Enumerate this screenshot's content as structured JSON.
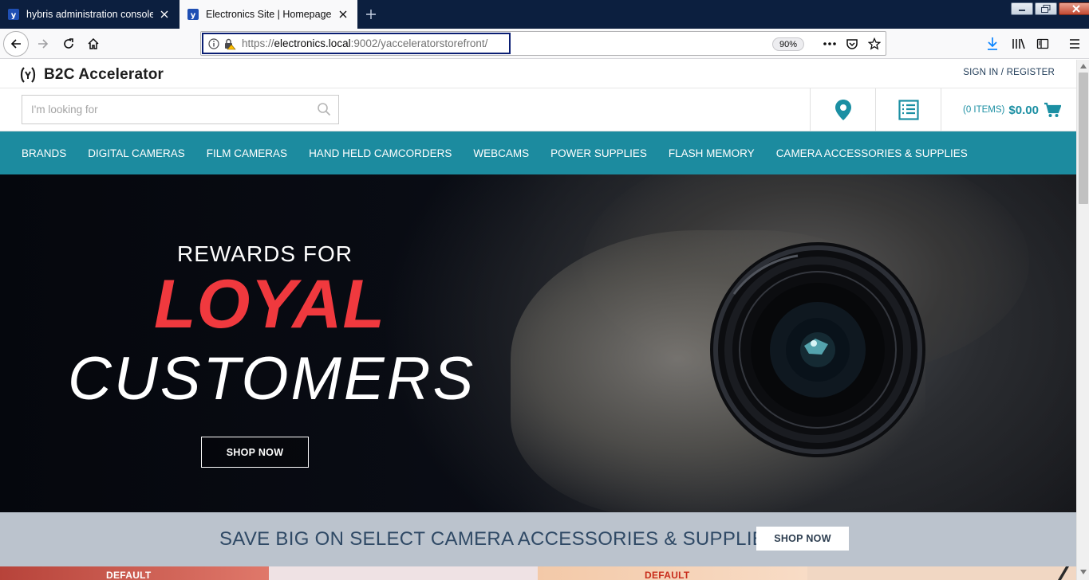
{
  "browser": {
    "tabs": [
      {
        "title": "hybris administration console |",
        "active": false
      },
      {
        "title": "Electronics Site | Homepage",
        "active": true
      }
    ],
    "url": {
      "scheme": "https://",
      "host": "electronics.local",
      "rest": ":9002/yacceleratorstorefront/"
    },
    "zoom": "90%"
  },
  "site": {
    "brand": "B2C Accelerator",
    "signin": "SIGN IN / REGISTER",
    "search_placeholder": "I'm looking for",
    "cart": {
      "items": "(0 ITEMS)",
      "total": "$0.00"
    },
    "categories": [
      "BRANDS",
      "DIGITAL CAMERAS",
      "FILM CAMERAS",
      "HAND HELD CAMCORDERS",
      "WEBCAMS",
      "POWER SUPPLIES",
      "FLASH MEMORY",
      "CAMERA ACCESSORIES & SUPPLIES"
    ],
    "hero": {
      "line1": "REWARDS FOR",
      "line2": "LOYAL",
      "line3": "CUSTOMERS",
      "button": "SHOP NOW"
    },
    "promo": {
      "text": "SAVE BIG ON SELECT CAMERA ACCESSORIES & SUPPLIES",
      "button": "SHOP NOW"
    },
    "tiles": [
      {
        "label": "DEFAULT"
      },
      {
        "label": "DEFAULT"
      }
    ]
  },
  "colors": {
    "tabstrip": "#0c1f3f",
    "nav_teal": "#1c8b9f",
    "loyal_red": "#f0393e",
    "promo_bg": "#bbc3cd",
    "promo_text": "#2f4965"
  },
  "icons": [
    "hybris-favicon",
    "close-icon",
    "plus-icon",
    "back-icon",
    "forward-icon",
    "reload-icon",
    "home-icon",
    "info-icon",
    "insecure-lock-icon",
    "more-icon",
    "pocket-icon",
    "star-icon",
    "download-icon",
    "library-icon",
    "sidebar-icon",
    "menu-icon",
    "search-icon",
    "location-pin-icon",
    "list-icon",
    "cart-icon"
  ]
}
